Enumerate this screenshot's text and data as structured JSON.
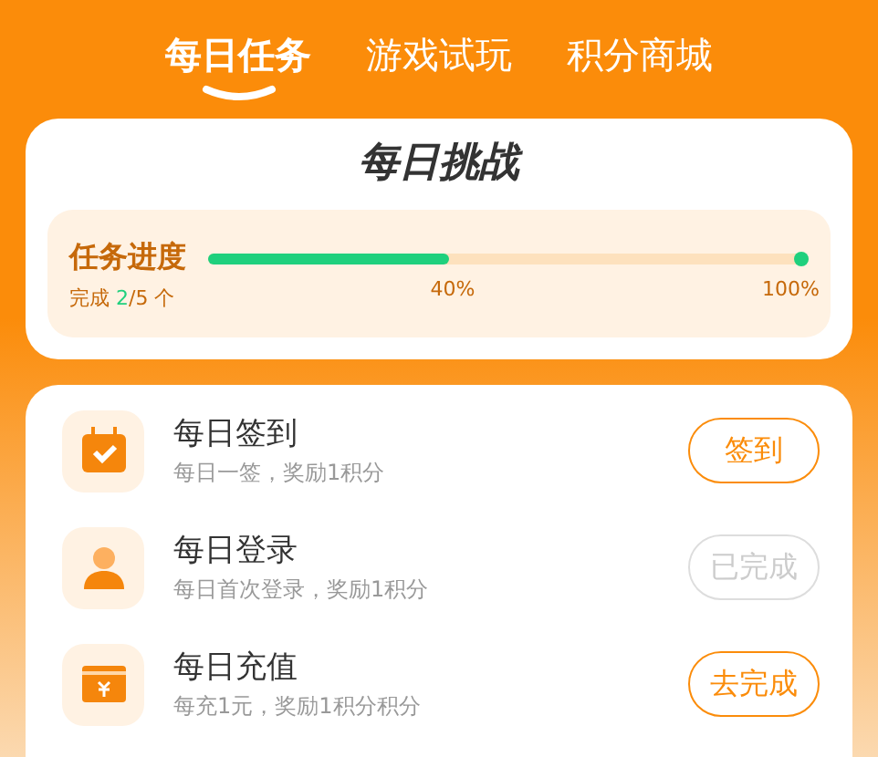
{
  "tabs": [
    {
      "label": "每日任务",
      "selected": true
    },
    {
      "label": "游戏试玩",
      "selected": false
    },
    {
      "label": "积分商城",
      "selected": false
    }
  ],
  "challenge": {
    "title": "每日挑战",
    "progress": {
      "label": "任务进度",
      "done_prefix": "完成",
      "done_count": "2",
      "done_suffix": "/5 个",
      "level": 0.4,
      "mid_label": "40%",
      "end_label": "100%"
    }
  },
  "tasks": [
    {
      "kind": "calendar",
      "title": "每日签到",
      "description": "每日一签，奖励1积分",
      "action": "签到",
      "completed": false
    },
    {
      "kind": "person",
      "title": "每日登录",
      "description": "每日首次登录，奖励1积分",
      "action": "已完成",
      "completed": true
    },
    {
      "kind": "wallet",
      "title": "每日充值",
      "description": "每充1元，奖励1积分积分",
      "action": "去完成",
      "completed": false
    }
  ]
}
